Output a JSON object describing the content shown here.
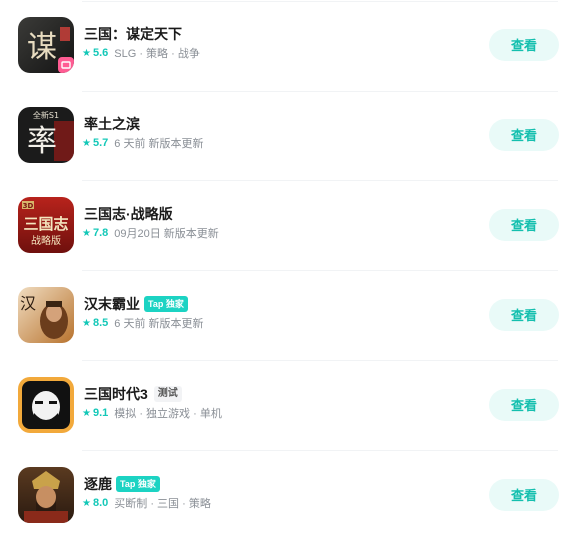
{
  "apps": [
    {
      "name": "三国：谋定天下",
      "rating": "5.6",
      "desc": "SLG · 策略 · 战争",
      "badge_top": "",
      "badge_test": "",
      "button": "查看",
      "icon": "game-icon-sanguo-mouding"
    },
    {
      "name": "率土之滨",
      "rating": "5.7",
      "desc": "6 天前 新版本更新",
      "badge_top": "",
      "badge_test": "",
      "button": "查看",
      "icon": "game-icon-shuaitu"
    },
    {
      "name": "三国志·战略版",
      "rating": "7.8",
      "desc": "09月20日 新版本更新",
      "badge_top": "",
      "badge_test": "",
      "button": "查看",
      "icon": "game-icon-sanguozhi"
    },
    {
      "name": "汉末霸业",
      "rating": "8.5",
      "desc": "6 天前 新版本更新",
      "badge_top": "Tap 独家",
      "badge_test": "",
      "button": "查看",
      "icon": "game-icon-hanmo"
    },
    {
      "name": "三国时代3",
      "rating": "9.1",
      "desc": "模拟 · 独立游戏 · 单机",
      "badge_top": "",
      "badge_test": "测试",
      "button": "查看",
      "icon": "game-icon-sanguo-shidai"
    },
    {
      "name": "逐鹿",
      "rating": "8.0",
      "desc": "买断制 · 三国 · 策略",
      "badge_top": "Tap 独家",
      "badge_test": "",
      "button": "查看",
      "icon": "game-icon-zhulu"
    }
  ],
  "icon_text": {
    "app0": "谋",
    "app1_top": "全新S1",
    "app1": "率",
    "app2_top": "3D",
    "app2_main": "三国志",
    "app2_sub": "战略版",
    "app3": "汉"
  },
  "colors": {
    "accent": "#14c8b8",
    "button_bg": "#e9faf8",
    "badge": "#1cd3c3"
  }
}
